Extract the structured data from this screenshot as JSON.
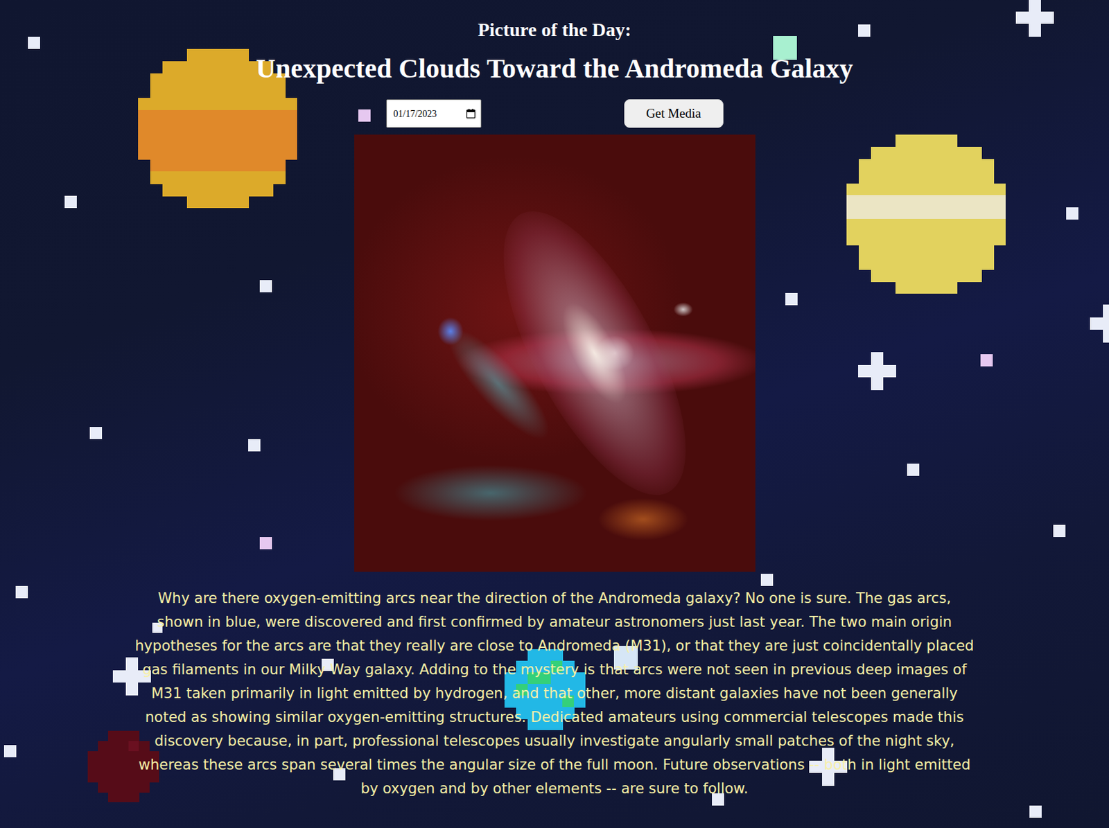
{
  "header": {
    "kicker": "Picture of the Day:",
    "title": "Unexpected Clouds Toward the Andromeda Galaxy"
  },
  "controls": {
    "date": "01/17/2023",
    "button": "Get Media"
  },
  "explanation": "Why are there oxygen-emitting arcs near the direction of the Andromeda galaxy? No one is sure. The gas arcs, shown in blue, were discovered and first confirmed by amateur astronomers just last year. The two main origin hypotheses for the arcs are that they really are close to Andromeda (M31), or that they are just coincidentally placed gas filaments in our Milky Way galaxy. Adding to the mystery is that arcs were not seen in previous deep images of M31 taken primarily in light emitted by hydrogen, and that other, more distant galaxies have not been generally noted as showing similar oxygen-emitting structures. Dedicated amateurs using commercial telescopes made this discovery because, in part, professional telescopes usually investigate angularly small patches of the night sky, whereas these arcs span several times the angular size of the full moon. Future observations -- both in light emitted by oxygen and by other elements -- are sure to follow."
}
